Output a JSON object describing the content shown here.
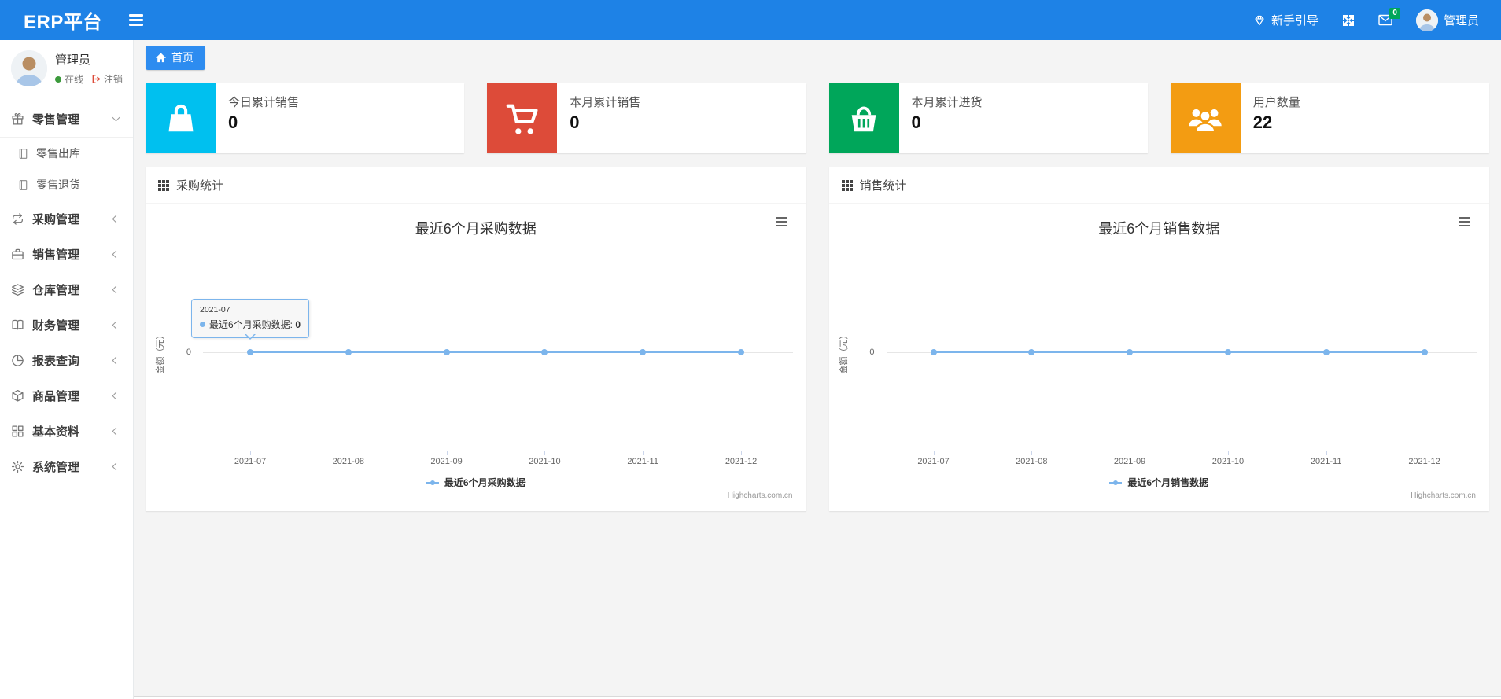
{
  "navbar": {
    "brand": "ERP平台",
    "guide_label": "新手引导",
    "message_badge": "0",
    "username": "管理员"
  },
  "sidebar": {
    "user": {
      "name": "管理员",
      "status": "在线",
      "logout": "注销"
    },
    "menu": [
      {
        "key": "retail-management",
        "icon": "gift-icon",
        "label": "零售管理",
        "expanded": true,
        "children": [
          {
            "key": "retail-outbound",
            "icon": "doc-icon",
            "label": "零售出库"
          },
          {
            "key": "retail-return",
            "icon": "doc-icon",
            "label": "零售退货"
          }
        ]
      },
      {
        "key": "purchase-management",
        "icon": "repeat-icon",
        "label": "采购管理"
      },
      {
        "key": "sales-management",
        "icon": "briefcase-icon",
        "label": "销售管理"
      },
      {
        "key": "warehouse-management",
        "icon": "layers-icon",
        "label": "仓库管理"
      },
      {
        "key": "finance-management",
        "icon": "book-icon",
        "label": "财务管理"
      },
      {
        "key": "report-query",
        "icon": "piechart-icon",
        "label": "报表查询"
      },
      {
        "key": "goods-management",
        "icon": "box-icon",
        "label": "商品管理"
      },
      {
        "key": "basic-data",
        "icon": "grid-icon",
        "label": "基本资料"
      },
      {
        "key": "system-management",
        "icon": "gear-icon",
        "label": "系统管理"
      }
    ]
  },
  "tabs": [
    {
      "key": "home",
      "icon": "home-icon",
      "label": "首页",
      "active": true
    }
  ],
  "stat_cards": [
    {
      "key": "today-sales",
      "label": "今日累计销售",
      "value": "0",
      "color": "#00c0ef",
      "icon": "shopping-bag-icon"
    },
    {
      "key": "month-sales",
      "label": "本月累计销售",
      "value": "0",
      "color": "#dd4b39",
      "icon": "cart-icon"
    },
    {
      "key": "month-purchase",
      "label": "本月累计进货",
      "value": "0",
      "color": "#00a65a",
      "icon": "basket-icon"
    },
    {
      "key": "user-count",
      "label": "用户数量",
      "value": "22",
      "color": "#f39c12",
      "icon": "users-icon"
    }
  ],
  "panels": [
    {
      "title": "采购统计"
    },
    {
      "title": "销售统计"
    }
  ],
  "chart_data": [
    {
      "type": "line",
      "title": "最近6个月采购数据",
      "x": [
        "2021-07",
        "2021-08",
        "2021-09",
        "2021-10",
        "2021-11",
        "2021-12"
      ],
      "series": [
        {
          "name": "最近6个月采购数据",
          "values": [
            0,
            0,
            0,
            0,
            0,
            0
          ]
        }
      ],
      "ylabel": "金额（元）",
      "yticks": [
        "0"
      ],
      "color": "#7cb5ec",
      "grid": true,
      "legend_position": "bottom",
      "credit": "Highcharts.com.cn",
      "tooltip": {
        "header": "2021-07",
        "series": "最近6个月采购数据",
        "value": "0"
      }
    },
    {
      "type": "line",
      "title": "最近6个月销售数据",
      "x": [
        "2021-07",
        "2021-08",
        "2021-09",
        "2021-10",
        "2021-11",
        "2021-12"
      ],
      "series": [
        {
          "name": "最近6个月销售数据",
          "values": [
            0,
            0,
            0,
            0,
            0,
            0
          ]
        }
      ],
      "ylabel": "金额（元）",
      "yticks": [
        "0"
      ],
      "color": "#7cb5ec",
      "grid": true,
      "legend_position": "bottom",
      "credit": "Highcharts.com.cn"
    }
  ]
}
